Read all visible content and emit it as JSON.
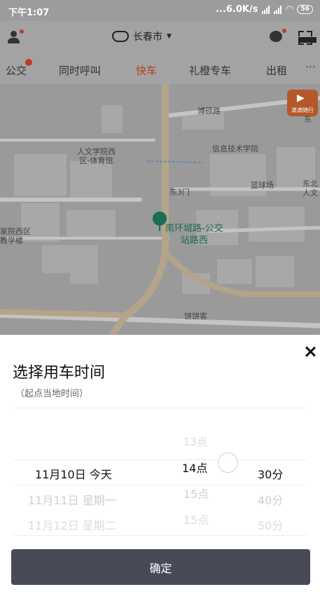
{
  "status_bar": {
    "time": "下午1:07",
    "network_speed": "...6.0K/s",
    "battery": "56"
  },
  "header": {
    "city": "长春市"
  },
  "service_tabs": [
    {
      "label": "公交"
    },
    {
      "label": "同时呼叫"
    },
    {
      "label": "快车"
    },
    {
      "label": "礼橙专车"
    },
    {
      "label": "出租"
    }
  ],
  "active_tab": "快车",
  "map": {
    "labels": {
      "road_bosuo": "博硕路",
      "renwen_west": "人文学院西\n区-体育馆",
      "info_tech": "信息技术学院",
      "dongsan_men": "东3门",
      "basketball": "篮球场",
      "dongbei_renwen": "东北\n人文",
      "nanyuan_west": "家院西区\n教学楼",
      "bingbing": "饼饼客",
      "east_edge": "东"
    },
    "poi_name": "南环城路-公交\n站路西",
    "badge_text": "滴滴随行"
  },
  "sheet": {
    "title": "选择用车时间",
    "subtitle": "（起点当地时间）",
    "date_column": {
      "selected": "11月10日 今天",
      "after": [
        "11月11日 星期一",
        "11月12日 星期二"
      ]
    },
    "hour_column": {
      "before": "13点",
      "selected": "14点",
      "after": [
        "15点",
        "15点"
      ]
    },
    "minute_column": {
      "selected": "30分",
      "after": [
        "40分",
        "50分"
      ]
    },
    "confirm_label": "确定"
  },
  "colors": {
    "accent": "#b0431e",
    "poi_green": "#1a6d57",
    "confirm_bg": "#494a57"
  }
}
